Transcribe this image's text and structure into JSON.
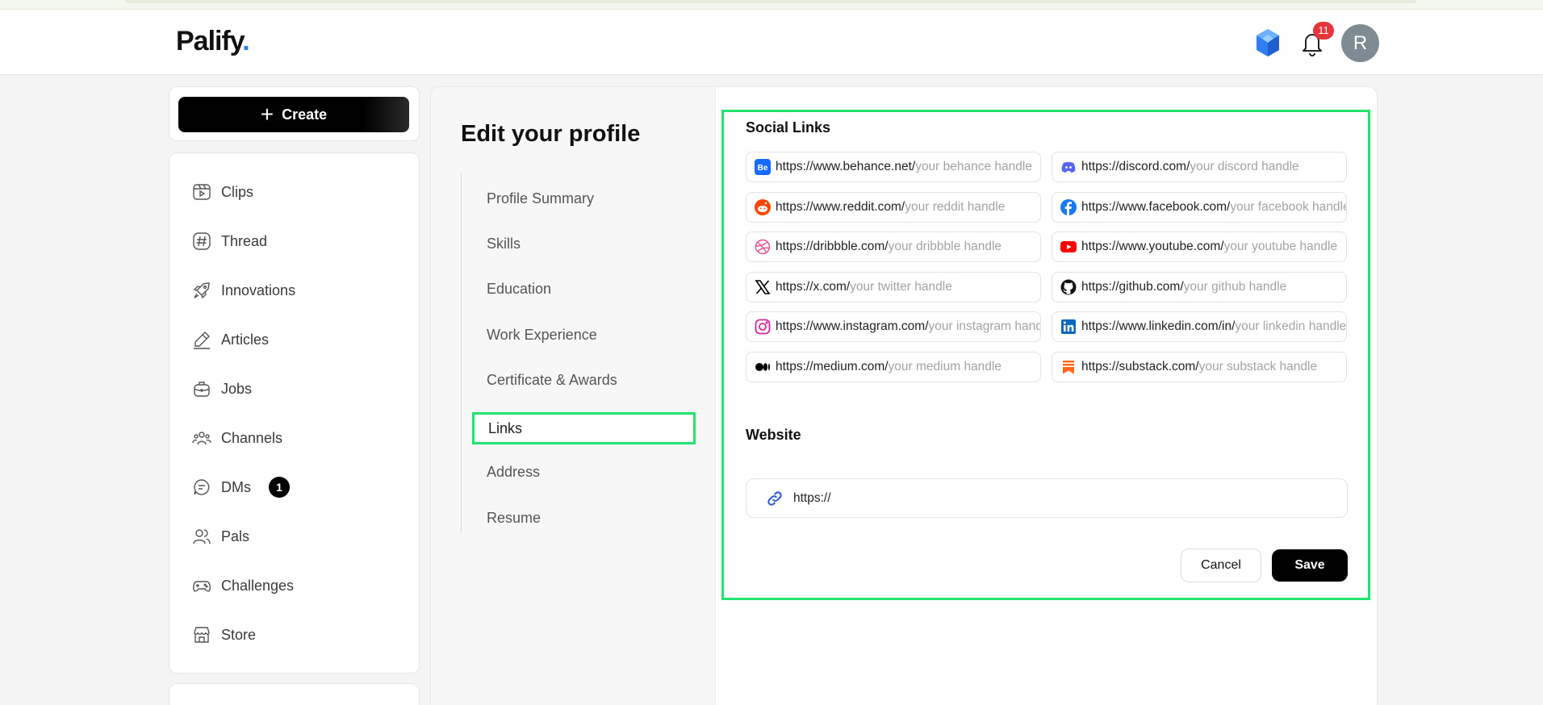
{
  "header": {
    "logo_text": "Palify",
    "logo_dot": ".",
    "notification_count": "11",
    "avatar_initial": "R"
  },
  "sidebar": {
    "create_label": "Create",
    "items": [
      {
        "label": "Clips",
        "icon": "clips-icon"
      },
      {
        "label": "Thread",
        "icon": "hashtag-icon"
      },
      {
        "label": "Innovations",
        "icon": "rocket-icon"
      },
      {
        "label": "Articles",
        "icon": "pen-icon"
      },
      {
        "label": "Jobs",
        "icon": "briefcase-icon"
      },
      {
        "label": "Channels",
        "icon": "channels-icon"
      },
      {
        "label": "DMs",
        "icon": "chat-icon",
        "badge": "1"
      },
      {
        "label": "Pals",
        "icon": "users-icon"
      },
      {
        "label": "Challenges",
        "icon": "gamepad-icon"
      },
      {
        "label": "Store",
        "icon": "store-icon"
      }
    ]
  },
  "profile": {
    "title": "Edit your profile",
    "sections": [
      "Profile Summary",
      "Skills",
      "Education",
      "Work Experience",
      "Certificate & Awards",
      "Links",
      "Address",
      "Resume"
    ],
    "active_section": "Links"
  },
  "links": {
    "social_title": "Social Links",
    "fields": [
      {
        "prefix": "https://www.behance.net/",
        "placeholder": "your behance handle",
        "icon": "behance-icon",
        "color": "#1769ff"
      },
      {
        "prefix": "https://discord.com/",
        "placeholder": "your discord handle",
        "icon": "discord-icon",
        "color": "#5865f2"
      },
      {
        "prefix": "https://www.reddit.com/",
        "placeholder": "your reddit handle",
        "icon": "reddit-icon",
        "color": "#ff4500"
      },
      {
        "prefix": "https://www.facebook.com/",
        "placeholder": "your facebook handle",
        "icon": "facebook-icon",
        "color": "#1877f2"
      },
      {
        "prefix": "https://dribbble.com/",
        "placeholder": "your dribbble handle",
        "icon": "dribbble-icon",
        "color": "#ea4c89"
      },
      {
        "prefix": "https://www.youtube.com/",
        "placeholder": "your youtube handle",
        "icon": "youtube-icon",
        "color": "#ff0000"
      },
      {
        "prefix": "https://x.com/",
        "placeholder": "your twitter handle",
        "icon": "x-icon",
        "color": "#000000"
      },
      {
        "prefix": "https://github.com/",
        "placeholder": "your github handle",
        "icon": "github-icon",
        "color": "#111111"
      },
      {
        "prefix": "https://www.instagram.com/",
        "placeholder": "your instagram handle",
        "icon": "instagram-icon",
        "color": "#d6249f"
      },
      {
        "prefix": "https://www.linkedin.com/in/",
        "placeholder": "your linkedin handle",
        "icon": "linkedin-icon",
        "color": "#0a66c2"
      },
      {
        "prefix": "https://medium.com/",
        "placeholder": "your medium handle",
        "icon": "medium-icon",
        "color": "#000000"
      },
      {
        "prefix": "https://substack.com/",
        "placeholder": "your substack handle",
        "icon": "substack-icon",
        "color": "#ff6719"
      }
    ],
    "website_title": "Website",
    "website_value": "https://",
    "cancel_label": "Cancel",
    "save_label": "Save"
  },
  "colors": {
    "highlight": "#21e46e",
    "accent": "#2b7bff",
    "badge": "#e5353a"
  }
}
